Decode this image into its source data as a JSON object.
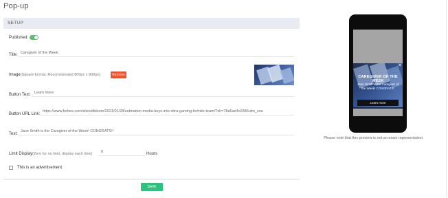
{
  "page": {
    "title": "Pop-up"
  },
  "section": {
    "header": "SETUP"
  },
  "form": {
    "published_label": "Published:",
    "published_on": true,
    "title_label": "Title:",
    "title_value": "Caregiver of the Week",
    "image_label": "Image",
    "image_hint": "(Square format. Recommended 800px x 800px)",
    "remove_label": "Remove",
    "button_text_label": "Button Text:",
    "button_text_value": "Learn more",
    "button_url_label": "Button URL Link:",
    "button_url_value": "https://www.forbes.com/sites/dbloom/2021/01/28/subnation-media-buys-into-xbra-gaming-fortnite-team/?sh=78a5ae4c0386utm_sou",
    "text_label": "Text:",
    "text_value": "Jane Smith is the Caregiver  of the Week! CONGRATS!!",
    "limit_label": "Limit Display",
    "limit_hint": "(Zero for no limit, display each time)",
    "limit_value": "0",
    "limit_unit": "Hours",
    "ad_label": "This is an advertisement",
    "ad_checked": false,
    "save_label": "SAVE"
  },
  "preview": {
    "popup_title": "CAREGIVER OF THE WEEK",
    "popup_text": "Jane Smith is the Caregiver of the Week! CONGRATS!",
    "popup_button": "Learn more",
    "close_glyph": "✕",
    "note": "Please note that this preview is not an exact representation."
  },
  "colors": {
    "toggle_on": "#58c36a",
    "remove": "#f0522e",
    "save": "#2ec27e",
    "section_bg": "#e8ecf2"
  }
}
